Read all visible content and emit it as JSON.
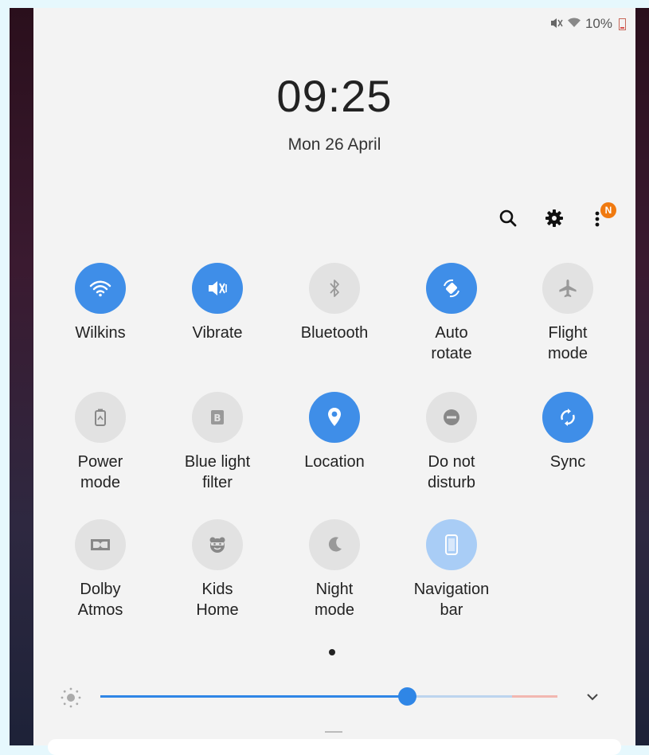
{
  "status_bar": {
    "battery_text": "10%",
    "mute_icon": "mute-icon",
    "wifi_icon": "wifi-icon"
  },
  "clock": {
    "time": "09:25",
    "date": "Mon 26 April"
  },
  "header": {
    "notification_badge": "N"
  },
  "tiles": [
    {
      "label": "Wilkins",
      "state": "on",
      "icon": "wifi-icon"
    },
    {
      "label": "Vibrate",
      "state": "on",
      "icon": "vibrate-icon"
    },
    {
      "label": "Bluetooth",
      "state": "off",
      "icon": "bluetooth-icon"
    },
    {
      "label": "Auto\nrotate",
      "state": "on",
      "icon": "auto-rotate-icon"
    },
    {
      "label": "Flight\nmode",
      "state": "off",
      "icon": "airplane-icon"
    },
    {
      "label": "Power\nmode",
      "state": "off",
      "icon": "power-mode-icon"
    },
    {
      "label": "Blue light\nfilter",
      "state": "off",
      "icon": "blue-light-icon"
    },
    {
      "label": "Location",
      "state": "on",
      "icon": "location-icon"
    },
    {
      "label": "Do not\ndisturb",
      "state": "off",
      "icon": "do-not-disturb-icon"
    },
    {
      "label": "Sync",
      "state": "on",
      "icon": "sync-icon"
    },
    {
      "label": "Dolby\nAtmos",
      "state": "off",
      "icon": "dolby-icon"
    },
    {
      "label": "Kids\nHome",
      "state": "off",
      "icon": "kids-home-icon"
    },
    {
      "label": "Night\nmode",
      "state": "off",
      "icon": "moon-icon"
    },
    {
      "label": "Navigation\nbar",
      "state": "light",
      "icon": "navigation-bar-icon"
    }
  ],
  "brightness": {
    "level_fraction": 0.67
  },
  "colors": {
    "accent": "#3f8ee8",
    "tile_off": "#e2e2e2",
    "panel": "#f3f3f3",
    "badge": "#f07a10"
  }
}
